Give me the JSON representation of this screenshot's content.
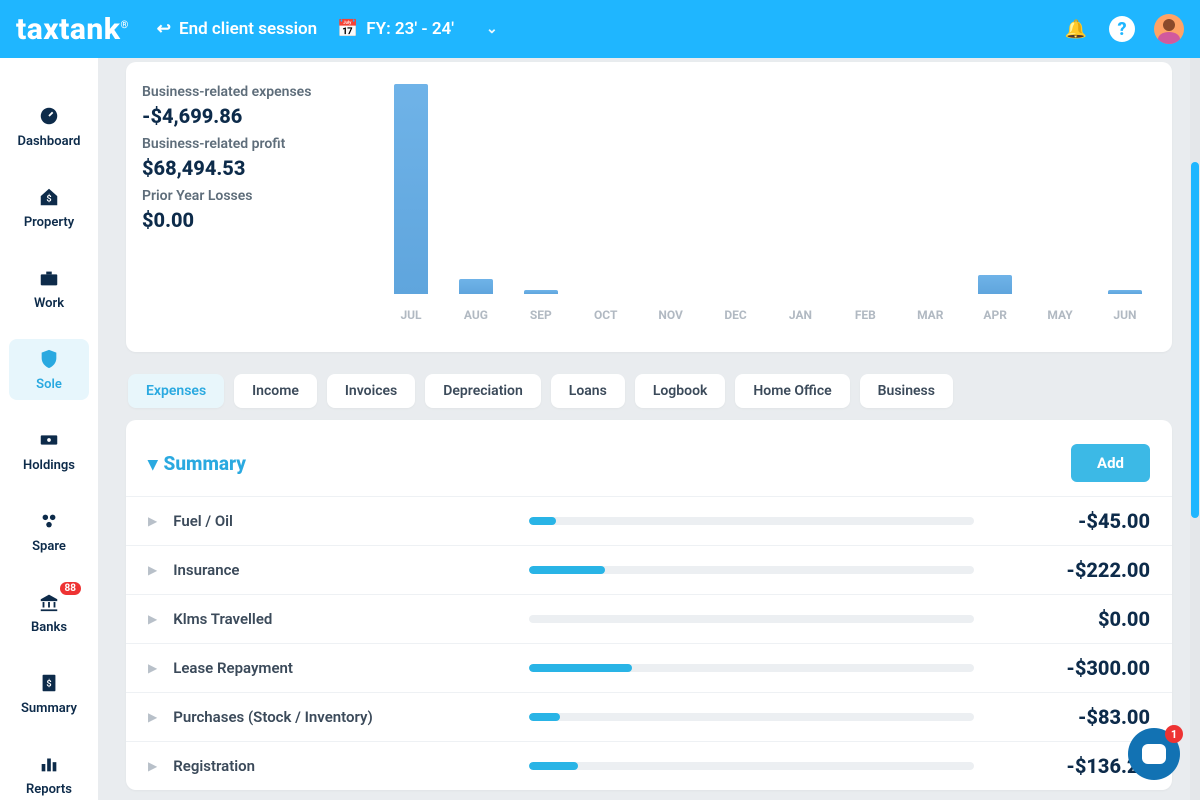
{
  "brand": {
    "name": "taxtank",
    "reg": "®"
  },
  "header": {
    "end_session": "End client session",
    "fy_label": "FY: 23' - 24'"
  },
  "nav": {
    "items": [
      {
        "label": "Dashboard",
        "icon": "gauge"
      },
      {
        "label": "Property",
        "icon": "home"
      },
      {
        "label": "Work",
        "icon": "briefcase"
      },
      {
        "label": "Sole",
        "icon": "shield",
        "active": true
      },
      {
        "label": "Holdings",
        "icon": "cash"
      },
      {
        "label": "Spare",
        "icon": "hex"
      },
      {
        "label": "Banks",
        "icon": "bank",
        "badge": "88"
      },
      {
        "label": "Summary",
        "icon": "doc"
      },
      {
        "label": "Reports",
        "icon": "bars"
      }
    ]
  },
  "metrics": [
    {
      "label": "Business-related expenses",
      "value": "-$4,699.86"
    },
    {
      "label": "Business-related profit",
      "value": "$68,494.53"
    },
    {
      "label": "Prior Year Losses",
      "value": "$0.00"
    }
  ],
  "chart_data": {
    "type": "bar",
    "categories": [
      "JUL",
      "AUG",
      "SEP",
      "OCT",
      "NOV",
      "DEC",
      "JAN",
      "FEB",
      "MAR",
      "APR",
      "MAY",
      "JUN"
    ],
    "values": [
      100,
      7,
      2,
      0,
      0,
      0,
      0,
      0,
      0,
      9,
      0,
      2
    ],
    "title": "",
    "xlabel": "",
    "ylabel": "",
    "ylim": [
      0,
      100
    ]
  },
  "tabs": [
    "Expenses",
    "Income",
    "Invoices",
    "Depreciation",
    "Loans",
    "Logbook",
    "Home Office",
    "Business"
  ],
  "active_tab": 0,
  "summary": {
    "title": "Summary",
    "add_label": "Add",
    "rows": [
      {
        "name": "Fuel / Oil",
        "amount": "-$45.00",
        "pct": 6
      },
      {
        "name": "Insurance",
        "amount": "-$222.00",
        "pct": 17
      },
      {
        "name": "Klms Travelled",
        "amount": "$0.00",
        "pct": 0
      },
      {
        "name": "Lease Repayment",
        "amount": "-$300.00",
        "pct": 23
      },
      {
        "name": "Purchases (Stock / Inventory)",
        "amount": "-$83.00",
        "pct": 7
      },
      {
        "name": "Registration",
        "amount": "-$136.25",
        "pct": 11
      }
    ]
  },
  "chat_badge": "1",
  "scroll": {
    "topPct": 14,
    "heightPct": 48
  }
}
